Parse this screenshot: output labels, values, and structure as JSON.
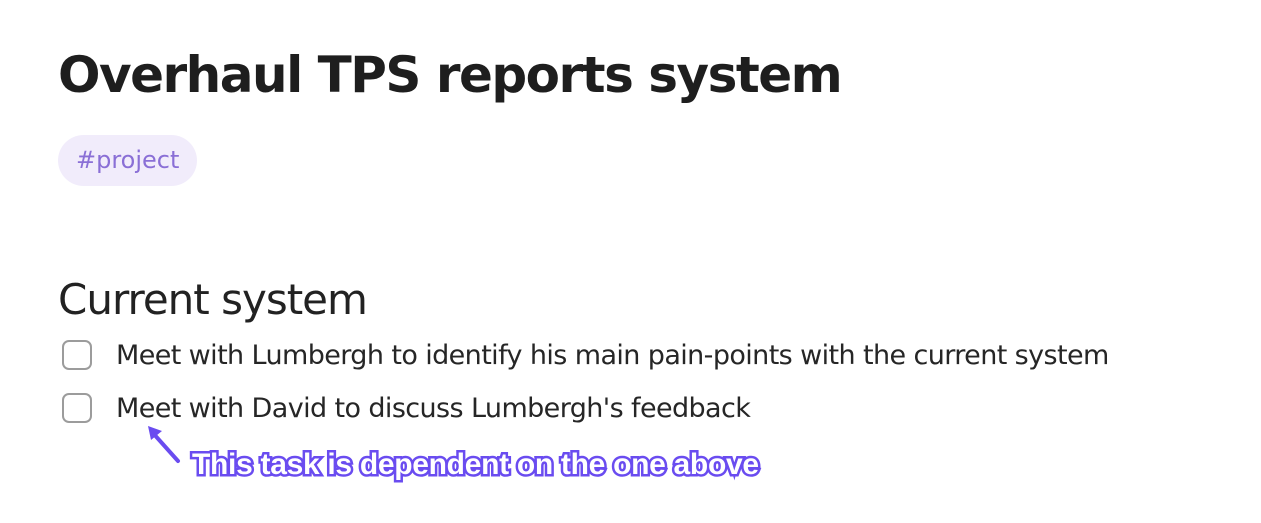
{
  "page": {
    "title": "Overhaul TPS reports system",
    "tag": "#project"
  },
  "section": {
    "heading": "Current system"
  },
  "tasks": [
    {
      "label": "Meet with Lumbergh to identify his main pain-points with the current system",
      "checked": false
    },
    {
      "label": "Meet with David to discuss Lumbergh's feedback",
      "checked": false
    }
  ],
  "annotation": {
    "text": "This task is dependent on the one above",
    "color": "#6a4cf0",
    "icon": "arrow-up-left-icon"
  },
  "colors": {
    "tag_background": "#f1ecfb",
    "tag_text": "#8a6fd6",
    "checkbox_border": "#9c9c9c"
  }
}
